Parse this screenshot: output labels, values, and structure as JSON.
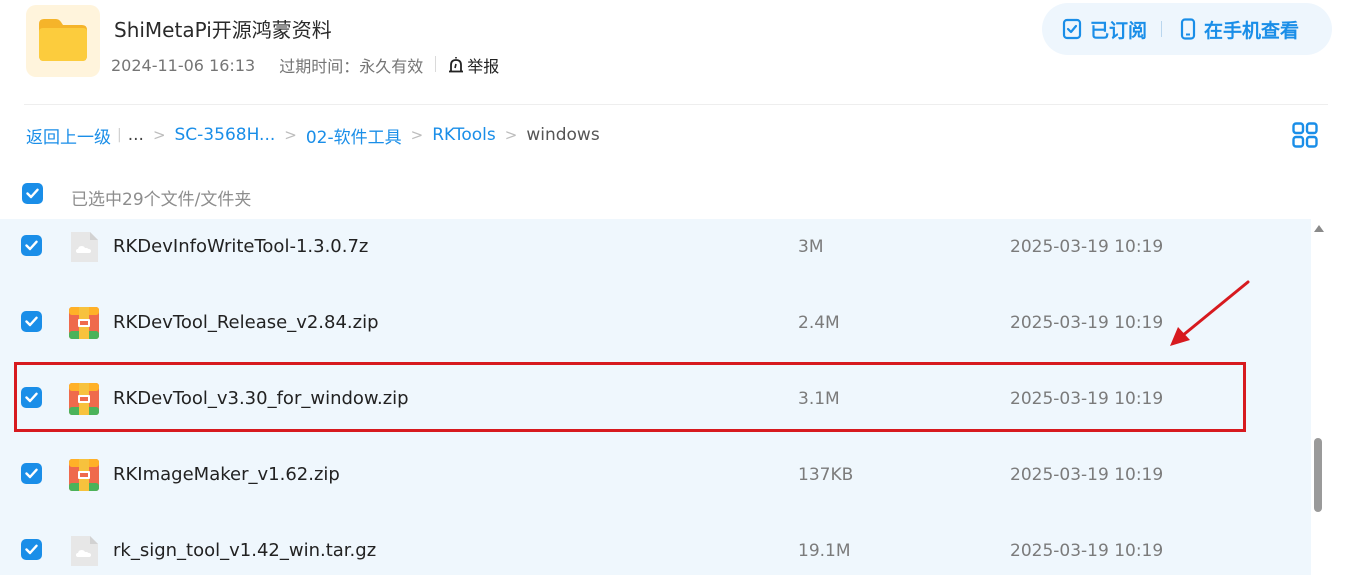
{
  "header": {
    "title": "ShiMetaPi开源鸿蒙资料",
    "date": "2024-11-06 16:13",
    "expire": "过期时间：永久有效",
    "report_label": "举报"
  },
  "actions": {
    "subscribed_label": "已订阅",
    "phone_view_label": "在手机查看"
  },
  "breadcrumb": {
    "back_label": "返回上一级",
    "ellipsis": "...",
    "items": [
      "SC-3568H...",
      "02-软件工具",
      "RKTools"
    ],
    "current": "windows"
  },
  "selection": {
    "label": "已选中29个文件/文件夹"
  },
  "files": [
    {
      "name": "RKDevInfoWriteTool-1.3.0.7z",
      "size": "3M",
      "date": "2025-03-19 10:19",
      "icon": "cloud-file-icon"
    },
    {
      "name": "RKDevTool_Release_v2.84.zip",
      "size": "2.4M",
      "date": "2025-03-19 10:19",
      "icon": "zip-archive-icon"
    },
    {
      "name": "RKDevTool_v3.30_for_window.zip",
      "size": "3.1M",
      "date": "2025-03-19 10:19",
      "icon": "zip-archive-icon"
    },
    {
      "name": "RKImageMaker_v1.62.zip",
      "size": "137KB",
      "date": "2025-03-19 10:19",
      "icon": "zip-archive-icon"
    },
    {
      "name": "rk_sign_tool_v1.42_win.tar.gz",
      "size": "19.1M",
      "date": "2025-03-19 10:19",
      "icon": "cloud-file-icon"
    }
  ],
  "colors": {
    "accent": "#1a8ee8",
    "list_bg": "#eff7fd",
    "highlight": "#d71a1f"
  }
}
